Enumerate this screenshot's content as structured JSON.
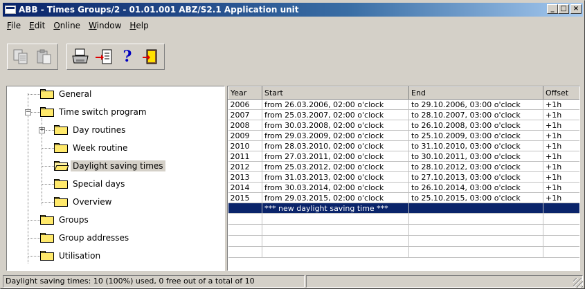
{
  "window": {
    "title": "ABB - Times Groups/2 - 01.01.001 ABZ/S2.1 Application unit",
    "minimize_label": "_",
    "maximize_label": "□",
    "close_label": "×"
  },
  "menu": [
    {
      "label": "File",
      "accel": "F",
      "rest": "ile"
    },
    {
      "label": "Edit",
      "accel": "E",
      "rest": "dit"
    },
    {
      "label": "Online",
      "accel": "O",
      "rest": "nline"
    },
    {
      "label": "Window",
      "accel": "W",
      "rest": "indow"
    },
    {
      "label": "Help",
      "accel": "H",
      "rest": "elp"
    }
  ],
  "toolbar": {
    "buttons": [
      "copy-icon",
      "paste-icon",
      "print-icon",
      "import-icon",
      "help-icon",
      "exit-icon"
    ],
    "help_glyph": "?"
  },
  "tree": [
    {
      "label": "General"
    },
    {
      "label": "Time switch program",
      "expanded": true
    },
    {
      "label": "Day routines",
      "collapsed": true
    },
    {
      "label": "Week routine"
    },
    {
      "label": "Daylight saving times",
      "selected": true
    },
    {
      "label": "Special days"
    },
    {
      "label": "Overview"
    },
    {
      "label": "Groups"
    },
    {
      "label": "Group addresses"
    },
    {
      "label": "Utilisation"
    }
  ],
  "grid": {
    "columns": [
      "Year",
      "Start",
      "End",
      "Offset"
    ],
    "rows": [
      [
        "2006",
        "from 26.03.2006, 02:00 o'clock",
        "to 29.10.2006, 03:00 o'clock",
        "+1h"
      ],
      [
        "2007",
        "from 25.03.2007, 02:00 o'clock",
        "to 28.10.2007, 03:00 o'clock",
        "+1h"
      ],
      [
        "2008",
        "from 30.03.2008, 02:00 o'clock",
        "to 26.10.2008, 03:00 o'clock",
        "+1h"
      ],
      [
        "2009",
        "from 29.03.2009, 02:00 o'clock",
        "to 25.10.2009, 03:00 o'clock",
        "+1h"
      ],
      [
        "2010",
        "from 28.03.2010, 02:00 o'clock",
        "to 31.10.2010, 03:00 o'clock",
        "+1h"
      ],
      [
        "2011",
        "from 27.03.2011, 02:00 o'clock",
        "to 30.10.2011, 03:00 o'clock",
        "+1h"
      ],
      [
        "2012",
        "from 25.03.2012, 02:00 o'clock",
        "to 28.10.2012, 03:00 o'clock",
        "+1h"
      ],
      [
        "2013",
        "from 31.03.2013, 02:00 o'clock",
        "to 27.10.2013, 03:00 o'clock",
        "+1h"
      ],
      [
        "2014",
        "from 30.03.2014, 02:00 o'clock",
        "to 26.10.2014, 03:00 o'clock",
        "+1h"
      ],
      [
        "2015",
        "from 29.03.2015, 02:00 o'clock",
        "to 25.10.2015, 03:00 o'clock",
        "+1h"
      ]
    ],
    "new_row_label": "*** new daylight saving time ***"
  },
  "status": {
    "text": "Daylight saving times: 10 (100%) used, 0 free out of a total of 10",
    "pane2": ""
  },
  "colors": {
    "titlebar": "#0a246a",
    "selection": "#0a246a",
    "folder": "#ffe96b",
    "face": "#d4d0c8"
  }
}
